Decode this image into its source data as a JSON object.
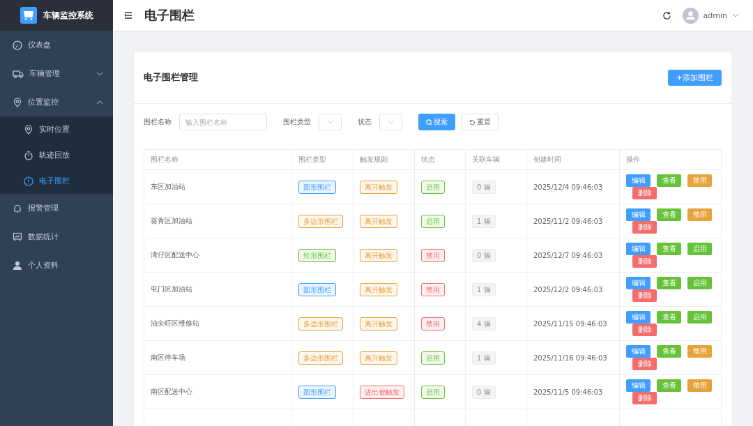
{
  "sidebar": {
    "logo_title": "车辆监控系统",
    "items": [
      {
        "label": "仪表盘",
        "selected": false
      },
      {
        "label": "车辆管理",
        "selected": false,
        "expanded": false
      },
      {
        "label": "位置监控",
        "selected": false,
        "expanded": true,
        "children": [
          {
            "label": "实时位置",
            "selected": false
          },
          {
            "label": "轨迹回放",
            "selected": false
          },
          {
            "label": "电子围栏",
            "selected": true
          }
        ]
      },
      {
        "label": "报警管理",
        "selected": false
      },
      {
        "label": "数据统计",
        "selected": false
      },
      {
        "label": "个人资料",
        "selected": false
      }
    ]
  },
  "header": {
    "title": "电子围栏",
    "user": "admin"
  },
  "card": {
    "title": "电子围栏管理",
    "add_button": "+添加围栏",
    "filters": {
      "name_label": "围栏名称",
      "name_placeholder": "输入围栏名称",
      "type_label": "围栏类型",
      "status_label": "状态",
      "search_button": "搜索",
      "reset_button": "重置"
    },
    "table": {
      "columns": [
        "围栏名称",
        "围栏类型",
        "触发规则",
        "状态",
        "关联车辆",
        "创建时间",
        "操作"
      ],
      "rows": [
        {
          "name": "东区加油站",
          "type": {
            "text": "圆形围栏",
            "color": "#409eff"
          },
          "rule": {
            "text": "离开触发",
            "color": "#e6a23c"
          },
          "status": {
            "text": "启用",
            "enabled": true
          },
          "vehicles": "0 辆",
          "created": "2025/12/4 09:46:03",
          "actions": [
            {
              "label": "编辑",
              "kind": "primary"
            },
            {
              "label": "查看",
              "kind": "success"
            },
            {
              "label": "禁用",
              "kind": "warning"
            },
            {
              "label": "删除",
              "kind": "danger"
            }
          ]
        },
        {
          "name": "葵青区加油站",
          "type": {
            "text": "多边形围栏",
            "color": "#e6a23c"
          },
          "rule": {
            "text": "离开触发",
            "color": "#e6a23c"
          },
          "status": {
            "text": "启用",
            "enabled": true
          },
          "vehicles": "1 辆",
          "created": "2025/11/2 09:46:03",
          "actions": [
            {
              "label": "编辑",
              "kind": "primary"
            },
            {
              "label": "查看",
              "kind": "success"
            },
            {
              "label": "禁用",
              "kind": "warning"
            },
            {
              "label": "删除",
              "kind": "danger"
            }
          ]
        },
        {
          "name": "湾仔区配送中心",
          "type": {
            "text": "矩形围栏",
            "color": "#67c23a"
          },
          "rule": {
            "text": "离开触发",
            "color": "#e6a23c"
          },
          "status": {
            "text": "禁用",
            "enabled": false
          },
          "vehicles": "0 辆",
          "created": "2025/12/7 09:46:03",
          "actions": [
            {
              "label": "编辑",
              "kind": "primary"
            },
            {
              "label": "查看",
              "kind": "success"
            },
            {
              "label": "启用",
              "kind": "success"
            },
            {
              "label": "删除",
              "kind": "danger"
            }
          ]
        },
        {
          "name": "屯门区加油站",
          "type": {
            "text": "圆形围栏",
            "color": "#409eff"
          },
          "rule": {
            "text": "离开触发",
            "color": "#e6a23c"
          },
          "status": {
            "text": "禁用",
            "enabled": false
          },
          "vehicles": "1 辆",
          "created": "2025/12/2 09:46:03",
          "actions": [
            {
              "label": "编辑",
              "kind": "primary"
            },
            {
              "label": "查看",
              "kind": "success"
            },
            {
              "label": "启用",
              "kind": "success"
            },
            {
              "label": "删除",
              "kind": "danger"
            }
          ]
        },
        {
          "name": "油尖旺区维修站",
          "type": {
            "text": "多边形围栏",
            "color": "#e6a23c"
          },
          "rule": {
            "text": "离开触发",
            "color": "#e6a23c"
          },
          "status": {
            "text": "禁用",
            "enabled": false
          },
          "vehicles": "4 辆",
          "created": "2025/11/15 09:46:03",
          "actions": [
            {
              "label": "编辑",
              "kind": "primary"
            },
            {
              "label": "查看",
              "kind": "success"
            },
            {
              "label": "启用",
              "kind": "success"
            },
            {
              "label": "删除",
              "kind": "danger"
            }
          ]
        },
        {
          "name": "南区停车场",
          "type": {
            "text": "多边形围栏",
            "color": "#e6a23c"
          },
          "rule": {
            "text": "离开触发",
            "color": "#e6a23c"
          },
          "status": {
            "text": "启用",
            "enabled": true
          },
          "vehicles": "1 辆",
          "created": "2025/11/16 09:46:03",
          "actions": [
            {
              "label": "编辑",
              "kind": "primary"
            },
            {
              "label": "查看",
              "kind": "success"
            },
            {
              "label": "禁用",
              "kind": "warning"
            },
            {
              "label": "删除",
              "kind": "danger"
            }
          ]
        },
        {
          "name": "南区配送中心",
          "type": {
            "text": "圆形围栏",
            "color": "#409eff"
          },
          "rule": {
            "text": "进出都触发",
            "color": "#f56c6c"
          },
          "status": {
            "text": "启用",
            "enabled": true
          },
          "vehicles": "0 辆",
          "created": "2025/11/5 09:46:03",
          "actions": [
            {
              "label": "编辑",
              "kind": "primary"
            },
            {
              "label": "查看",
              "kind": "success"
            },
            {
              "label": "禁用",
              "kind": "warning"
            },
            {
              "label": "删除",
              "kind": "danger"
            }
          ]
        }
      ]
    }
  }
}
